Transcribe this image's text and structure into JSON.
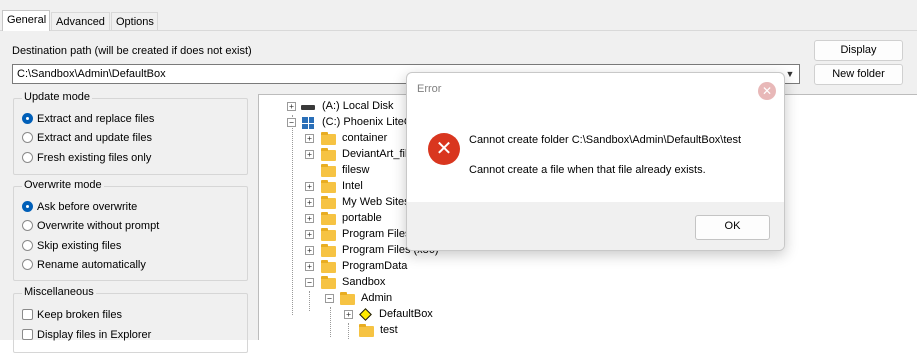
{
  "tabs": [
    "General",
    "Advanced",
    "Options"
  ],
  "destination": {
    "label": "Destination path (will be created if does not exist)",
    "value": "C:\\Sandbox\\Admin\\DefaultBox"
  },
  "buttons": {
    "display": "Display",
    "new_folder": "New folder"
  },
  "update_mode": {
    "title": "Update mode",
    "options": [
      "Extract and replace files",
      "Extract and update files",
      "Fresh existing files only"
    ],
    "selected": 0
  },
  "overwrite_mode": {
    "title": "Overwrite mode",
    "options": [
      "Ask before overwrite",
      "Overwrite without prompt",
      "Skip existing files",
      "Rename automatically"
    ],
    "selected": 0
  },
  "misc": {
    "title": "Miscellaneous",
    "options": [
      "Keep broken files",
      "Display files in Explorer"
    ]
  },
  "tree": {
    "drive_a": "(A:) Local Disk",
    "drive_c": "(C:) Phoenix LiteOS",
    "folders": [
      "container",
      "DeviantArt_files",
      "filesw",
      "Intel",
      "My Web Sites",
      "portable",
      "Program Files",
      "Program Files (x86)",
      "ProgramData",
      "Sandbox"
    ],
    "admin": "Admin",
    "defaultbox": "DefaultBox",
    "test": "test"
  },
  "dialog": {
    "title": "Error",
    "message": "Cannot create folder C:\\Sandbox\\Admin\\DefaultBox\\test",
    "detail": "Cannot create a file when that file already exists.",
    "ok": "OK"
  }
}
